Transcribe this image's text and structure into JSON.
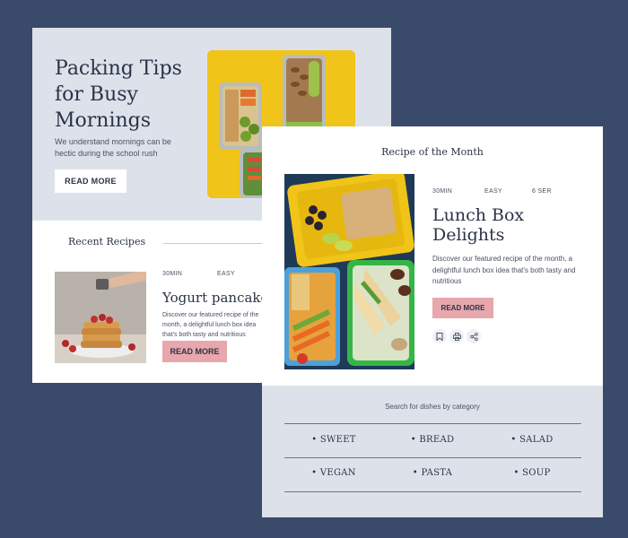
{
  "hero": {
    "title": "Packing Tips for Busy Mornings",
    "description": "We understand mornings can be hectic during the school rush",
    "read_more": "READ MORE"
  },
  "recent": {
    "heading": "Recent Recipes",
    "item": {
      "time": "30MIN",
      "difficulty": "EASY",
      "title": "Yogurt pancakes",
      "description": "Discover our featured recipe of the month, a delightful lunch box idea that's both tasty and nutritious",
      "read_more": "READ MORE"
    }
  },
  "featured": {
    "heading": "Recipe of the Month",
    "time": "30MIN",
    "difficulty": "EASY",
    "servings": "6 SER",
    "title": "Lunch Box Delights",
    "description": "Discover our featured recipe of the month, a delightful lunch box idea that's both tasty and nutritious",
    "read_more": "READ MORE"
  },
  "categories": {
    "label": "Search for dishes by category",
    "items": [
      "• SWEET",
      "• BREAD",
      "• SALAD",
      "• VEGAN",
      "• PASTA",
      "• SOUP"
    ]
  },
  "colors": {
    "background": "#3a4a6b",
    "hero_bg": "#dde2ea",
    "accent_pink": "#e8a7ad",
    "text_dark": "#2b3348"
  }
}
